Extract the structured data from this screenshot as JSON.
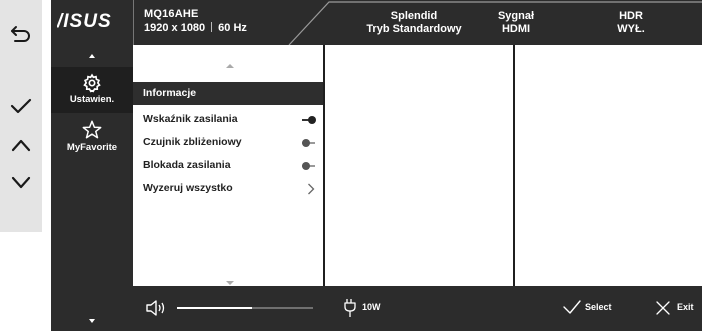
{
  "keys": {
    "items": [
      {
        "name": "back-icon"
      },
      {
        "name": "check-icon"
      },
      {
        "name": "chevron-up-icon"
      },
      {
        "name": "chevron-down-icon"
      }
    ]
  },
  "header": {
    "logo_text": "/ISUS",
    "model": "MQ16AHE",
    "resolution": "1920 x 1080",
    "refresh_rate": "60 Hz",
    "splendid_label": "Splendid",
    "splendid_value": "Tryb Standardowy",
    "signal_label": "Sygnał",
    "signal_value": "HDMI",
    "hdr_label": "HDR",
    "hdr_value": "WYŁ."
  },
  "sidebar": {
    "categories": [
      {
        "label": "Ustawien.",
        "icon": "gear-icon",
        "selected": true
      },
      {
        "label": "MyFavorite",
        "icon": "star-icon",
        "selected": false
      }
    ]
  },
  "menu": {
    "items": [
      {
        "label": "Informacje",
        "selected": true,
        "control": "none"
      },
      {
        "label": "Wskaźnik zasilania",
        "selected": false,
        "control": "toggle-on"
      },
      {
        "label": "Czujnik zbliżeniowy",
        "selected": false,
        "control": "toggle-off"
      },
      {
        "label": "Blokada zasilania",
        "selected": false,
        "control": "toggle-off"
      },
      {
        "label": "Wyzeruj wszystko",
        "selected": false,
        "control": "chevron-right"
      }
    ]
  },
  "footer": {
    "volume_level": 0.55,
    "power_value": "10W",
    "select_label": "Select",
    "exit_label": "Exit"
  },
  "colors": {
    "osd_dark": "#2c2c2c",
    "osd_darker": "#1f1f1f",
    "key_strip": "#e4e4e4",
    "panel": "#ffffff"
  }
}
